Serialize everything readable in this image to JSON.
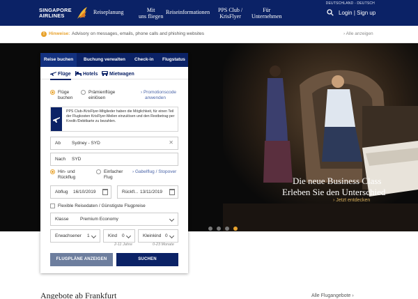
{
  "header": {
    "logo_line1": "SINGAPORE",
    "logo_line2": "AIRLINES",
    "nav": [
      {
        "line1": "Reiseplanung",
        "line2": ""
      },
      {
        "line1": "Mit",
        "line2": "uns fliegen"
      },
      {
        "line1": "Reiseinformationen",
        "line2": ""
      },
      {
        "line1": "PPS Club /",
        "line2": "KrisFlyer"
      },
      {
        "line1": "Für",
        "line2": "Unternehmen"
      }
    ],
    "locale": "DEUTSCHLAND - DEUTSCH",
    "login": "Login",
    "separator": "|",
    "signup": "Sign up"
  },
  "advisory": {
    "label": "Hinweise:",
    "text": "Advisory on messages, emails, phone calls and phishing websites",
    "all": "› Alle anzeigen"
  },
  "hero": {
    "headline1": "Die neue Business Class",
    "headline2": "Erleben Sie den Unterschied",
    "cta": "› Jetzt entdecken",
    "slide_count": 4,
    "active_slide": 4
  },
  "booking": {
    "tabs": [
      "Reise buchen",
      "Buchung verwalten",
      "Check-in",
      "Flugstatus"
    ],
    "subtabs": [
      "Flüge",
      "Hotels",
      "Mietwagen"
    ],
    "fare_type": {
      "option1_line1": "Flüge",
      "option1_line2": "buchen",
      "option2_line1": "Prämienflüge",
      "option2_line2": "einlösen",
      "promo_line1": "› Promotionscode",
      "promo_line2": "anwenden"
    },
    "info": "PPS Club-/KrisFlyer-Mitglieder haben die Möglichkeit, für einen Teil der Flugkosten KrisFlyer-Meilen einzulösen und den Restbetrag per Kredit-/Debitkarte zu bezahlen.",
    "from_label": "Ab",
    "from_value": "Sydney - SYD",
    "to_label": "Nach",
    "to_value": "SYD",
    "trip": {
      "option1_line1": "Hin- und",
      "option1_line2": "Rückflug",
      "option2_line1": "Einfacher",
      "option2_line2": "Flug",
      "multi": "› Gabelflug / Stopover"
    },
    "depart_label": "Abflug",
    "depart_value": "16/10/2019",
    "return_label": "Rückfl...",
    "return_value": "13/11/2019",
    "flexible": "Flexible Reisedaten / Günstigste Flugpreise",
    "class_label": "Klasse",
    "class_value": "Premium Economy",
    "adults_label": "Erwachsener",
    "adults_value": "1",
    "children_label": "Kind",
    "children_value": "0",
    "infants_label": "Kleinkind",
    "infants_value": "0",
    "children_hint": "2-11 Jahre",
    "infants_hint": "0-23 Monate",
    "btn_plans": "FLUGPLÄNE ANZEIGEN",
    "btn_search": "SUCHEN"
  },
  "below": {
    "offers_title": "Angebote ab Frankfurt",
    "right_text": "Alle Flugangebote ›"
  },
  "colors": {
    "navy": "#0b2266",
    "gold": "#e8a32e",
    "muted_button": "#6d7e9e"
  }
}
